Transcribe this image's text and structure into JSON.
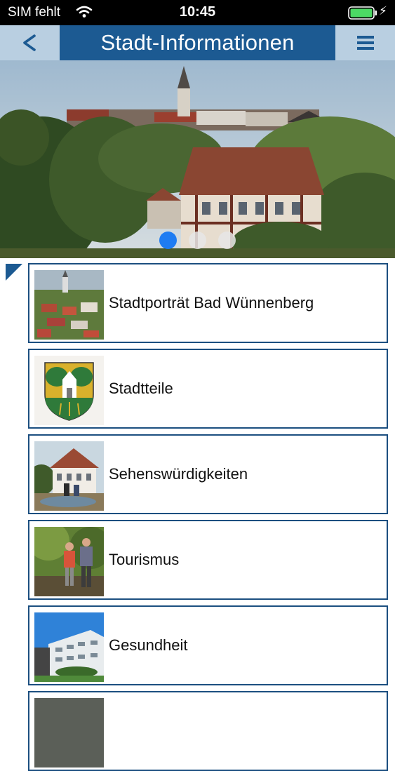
{
  "status_bar": {
    "carrier": "SIM fehlt",
    "time": "10:45",
    "battery_color": "#4cd964"
  },
  "nav": {
    "back_label": "<",
    "title": "Stadt-Informationen",
    "menu_icon": "hamburger-menu-icon",
    "bar_color": "#b9cfe1",
    "title_color": "#1c5a92"
  },
  "hero": {
    "slide_count": 3,
    "active_slide": 1,
    "active_dot_color": "#1e7cf2"
  },
  "list": {
    "items": [
      {
        "label": "Stadtporträt Bad Wünnenberg",
        "thumbnail": "town-aerial-photo"
      },
      {
        "label": "Stadtteile",
        "thumbnail": "coat-of-arms"
      },
      {
        "label": "Sehenswürdigkeiten",
        "thumbnail": "half-timbered-house-photo"
      },
      {
        "label": "Tourismus",
        "thumbnail": "hikers-photo"
      },
      {
        "label": "Gesundheit",
        "thumbnail": "clinic-building-photo"
      }
    ]
  }
}
